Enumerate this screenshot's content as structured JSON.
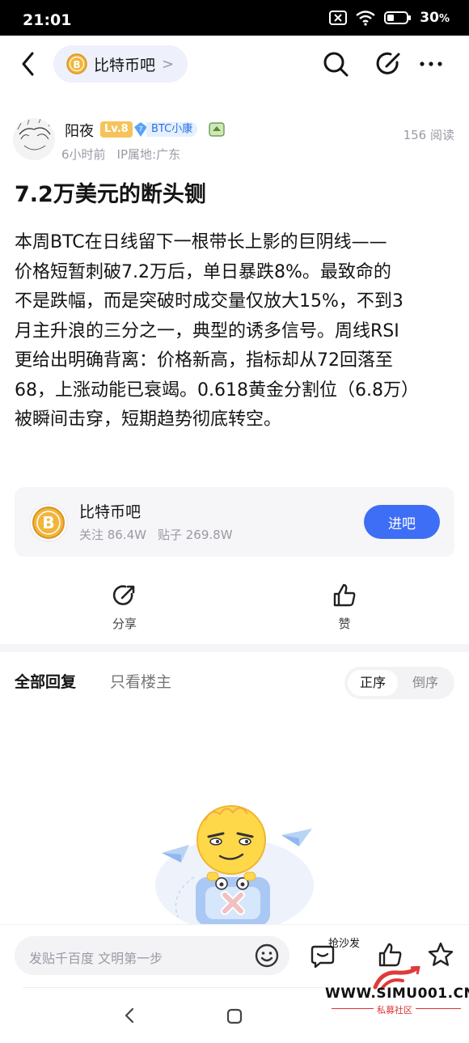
{
  "status_bar": {
    "time": "21:01",
    "battery": "30"
  },
  "nav": {
    "forum_name": "比特币吧",
    "forum_chevron": ">"
  },
  "post": {
    "author": "阳夜",
    "level": "Lv.8",
    "badge_num": "7",
    "badge_text": "BTC小康",
    "time": "6小时前",
    "location": "IP属地:广东",
    "reads": "156 阅读",
    "title": "7.2万美元的断头铡",
    "lines": [
      "本周BTC在日线留下一根带长上影的巨阴线——",
      "价格短暂刺破7.2万后，单日暴跌8%。最致命的",
      "不是跌幅，而是突破时成交量仅放大15%，不到3",
      "月主升浪的三分之一，典型的诱多信号。周线RSI",
      "更给出明确背离：价格新高，指标却从72回落至",
      "68，上涨动能已衰竭。0.618黄金分割位（6.8万）",
      "被瞬间击穿，短期趋势彻底转空。"
    ]
  },
  "forum_card": {
    "name": "比特币吧",
    "follow": "关注 86.4W",
    "posts": "贴子 269.8W",
    "join": "进吧"
  },
  "actions": {
    "share": "分享",
    "like": "赞"
  },
  "replies": {
    "tab_all": "全部回复",
    "tab_op": "只看楼主",
    "sort_asc": "正序",
    "sort_desc": "倒序"
  },
  "bottom": {
    "placeholder": "发贴千百度 文明第一步",
    "sofa": "抢沙发"
  },
  "watermark": {
    "url": "WWW.SIMU001.CN",
    "sub": "私募社区"
  },
  "colors": {
    "accent": "#3d6ef5",
    "level": "#f5c35a",
    "coin": "#f2b53a"
  }
}
